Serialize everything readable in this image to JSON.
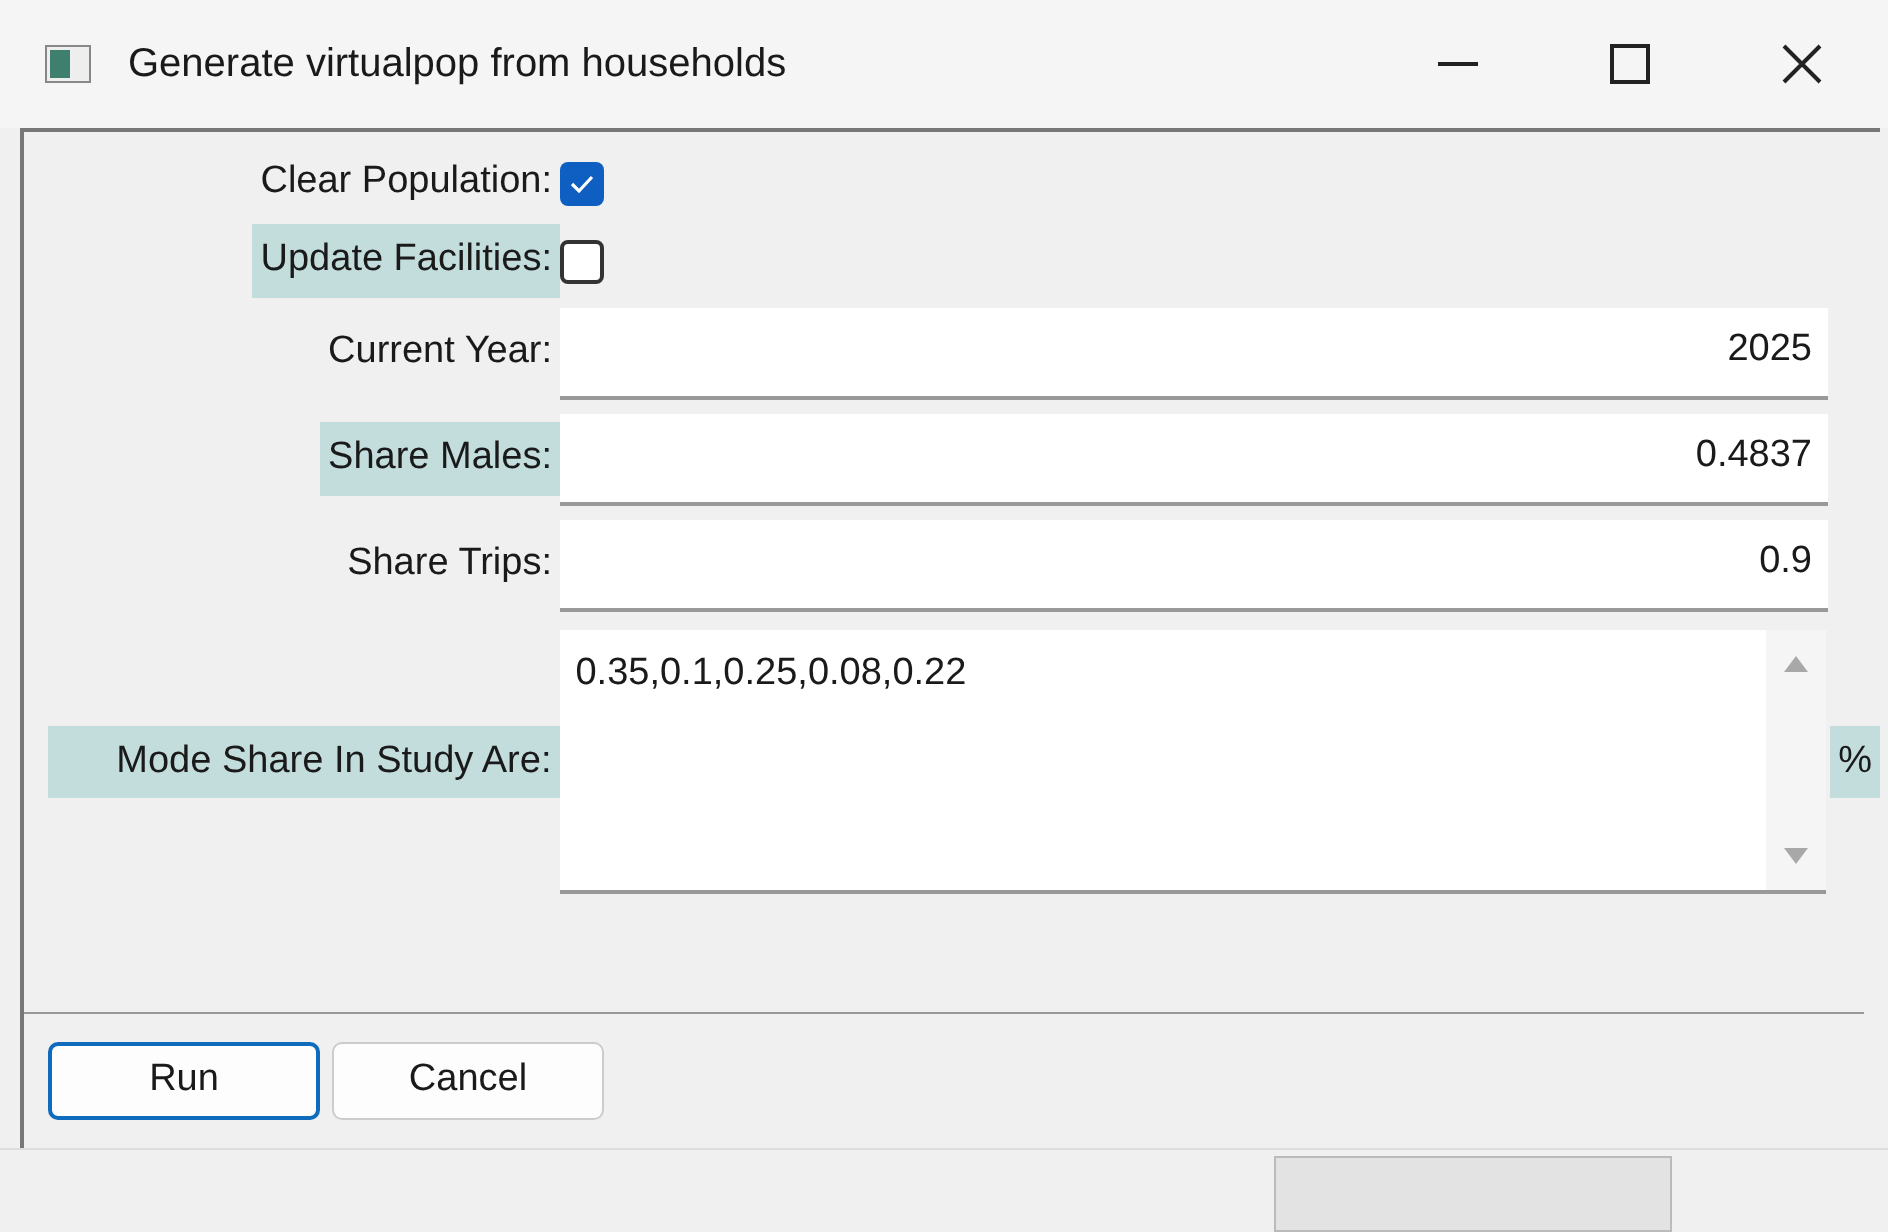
{
  "window": {
    "title": "Generate virtualpop from households"
  },
  "fields": [
    {
      "kind": "checkbox",
      "label": "Clear Population:",
      "highlighted": false,
      "checked": true
    },
    {
      "kind": "checkbox",
      "label": "Update Facilities:",
      "highlighted": true,
      "checked": false
    },
    {
      "kind": "text",
      "label": "Current Year:",
      "highlighted": false,
      "value": "2025"
    },
    {
      "kind": "text",
      "label": "Share Males:",
      "highlighted": true,
      "value": "0.4837"
    },
    {
      "kind": "text",
      "label": "Share Trips:",
      "highlighted": false,
      "value": "0.9"
    },
    {
      "kind": "textarea",
      "label": "Mode Share In Study Are:",
      "highlighted": true,
      "value": "0.35,0.1,0.25,0.08,0.22",
      "suffix": "%"
    }
  ],
  "buttons": [
    {
      "label": "Run",
      "selected": true
    },
    {
      "label": "Cancel",
      "selected": false
    }
  ]
}
